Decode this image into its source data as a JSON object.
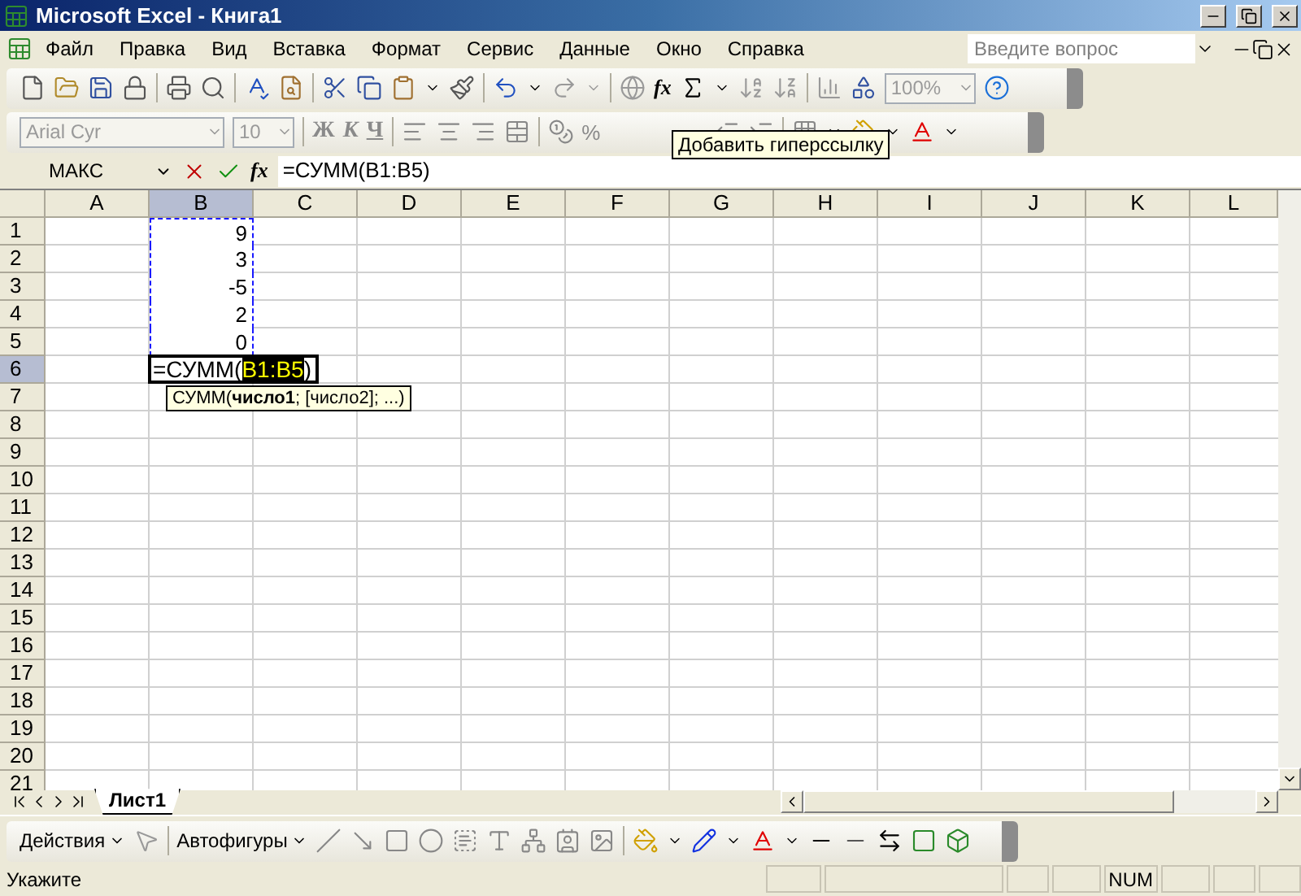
{
  "window": {
    "title": "Microsoft Excel - Книга1"
  },
  "menu": {
    "items": [
      "Файл",
      "Правка",
      "Вид",
      "Вставка",
      "Формат",
      "Сервис",
      "Данные",
      "Окно",
      "Справка"
    ],
    "help_placeholder": "Введите вопрос"
  },
  "standard_toolbar": {
    "function_label": "fx",
    "zoom": "100%"
  },
  "format_toolbar": {
    "font": "Arial Cyr",
    "size": "10",
    "styles": [
      {
        "label": "Ж",
        "kind": "bold"
      },
      {
        "label": "К",
        "kind": "italic"
      },
      {
        "label": "Ч",
        "kind": "underline"
      }
    ],
    "percent": "%"
  },
  "tooltip": "Добавить гиперссылку",
  "formula_bar": {
    "name_box": "МАКС",
    "fx_label": "fx",
    "formula": "=СУММ(B1:B5)"
  },
  "grid": {
    "columns": [
      {
        "label": "A",
        "selected": false
      },
      {
        "label": "B",
        "selected": true
      },
      {
        "label": "C",
        "selected": false
      },
      {
        "label": "D",
        "selected": false
      },
      {
        "label": "E",
        "selected": false
      },
      {
        "label": "F",
        "selected": false
      },
      {
        "label": "G",
        "selected": false
      },
      {
        "label": "H",
        "selected": false
      },
      {
        "label": "I",
        "selected": false
      },
      {
        "label": "J",
        "selected": false
      },
      {
        "label": "K",
        "selected": false
      },
      {
        "label": "L",
        "selected": false
      }
    ],
    "rows": [
      {
        "header": "1",
        "selected": false,
        "in_range": true,
        "column_b": "9"
      },
      {
        "header": "2",
        "selected": false,
        "in_range": true,
        "column_b": "3"
      },
      {
        "header": "3",
        "selected": false,
        "in_range": true,
        "column_b": "-5"
      },
      {
        "header": "4",
        "selected": false,
        "in_range": true,
        "column_b": "2"
      },
      {
        "header": "5",
        "selected": false,
        "in_range": true,
        "column_b": "0"
      },
      {
        "header": "6",
        "selected": true,
        "in_range": false,
        "editing": {
          "before": "=СУММ(",
          "reference": "B1:B5",
          "after": ")"
        }
      },
      {
        "header": "7",
        "selected": false,
        "in_range": false,
        "hint": "СУММ(**число1**; [число2]; ...)"
      },
      {
        "header": "8",
        "selected": false,
        "in_range": false
      },
      {
        "header": "9",
        "selected": false,
        "in_range": false
      },
      {
        "header": "10",
        "selected": false,
        "in_range": false
      },
      {
        "header": "11",
        "selected": false,
        "in_range": false
      },
      {
        "header": "12",
        "selected": false,
        "in_range": false
      },
      {
        "header": "13",
        "selected": false,
        "in_range": false
      },
      {
        "header": "14",
        "selected": false,
        "in_range": false
      },
      {
        "header": "15",
        "selected": false,
        "in_range": false
      },
      {
        "header": "16",
        "selected": false,
        "in_range": false
      },
      {
        "header": "17",
        "selected": false,
        "in_range": false
      },
      {
        "header": "18",
        "selected": false,
        "in_range": false
      },
      {
        "header": "19",
        "selected": false,
        "in_range": false
      },
      {
        "header": "20",
        "selected": false,
        "in_range": false
      },
      {
        "header": "21",
        "selected": false,
        "in_range": false
      }
    ]
  },
  "sheet_tabs": [
    {
      "label": "Лист1",
      "selected": true
    }
  ],
  "drawing_toolbar": {
    "actions": "Действия",
    "autoshapes": "Автофигуры"
  },
  "status_bar": {
    "mode": "Укажите",
    "num": "NUM"
  }
}
